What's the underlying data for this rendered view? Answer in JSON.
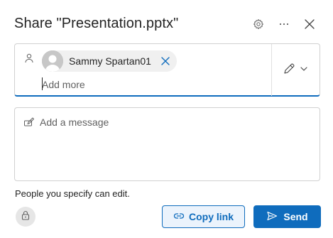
{
  "dialog": {
    "title": "Share \"Presentation.pptx\"",
    "settings_icon": "gear-icon",
    "more_icon": "more-horizontal-icon",
    "close_icon": "close-icon"
  },
  "recipients": {
    "icon": "person-icon",
    "chips": [
      {
        "name": "Sammy Spartan01",
        "avatar": "default-avatar",
        "remove_icon": "dismiss-icon"
      }
    ],
    "input_placeholder": "Add more",
    "input_value": "",
    "permission_icon": "pencil-icon",
    "permission_dropdown_icon": "chevron-down-icon"
  },
  "message": {
    "icon": "compose-icon",
    "placeholder": "Add a message",
    "value": ""
  },
  "permission_summary": "People you specify can edit.",
  "footer": {
    "lock_icon": "lock-icon",
    "copy_link_label": "Copy link",
    "copy_link_icon": "link-icon",
    "send_label": "Send",
    "send_icon": "send-icon"
  },
  "colors": {
    "accent": "#0f6cbd",
    "accent_light": "#ebf3fc",
    "text": "#242424",
    "placeholder": "#616161",
    "border": "#d1d1d1"
  }
}
